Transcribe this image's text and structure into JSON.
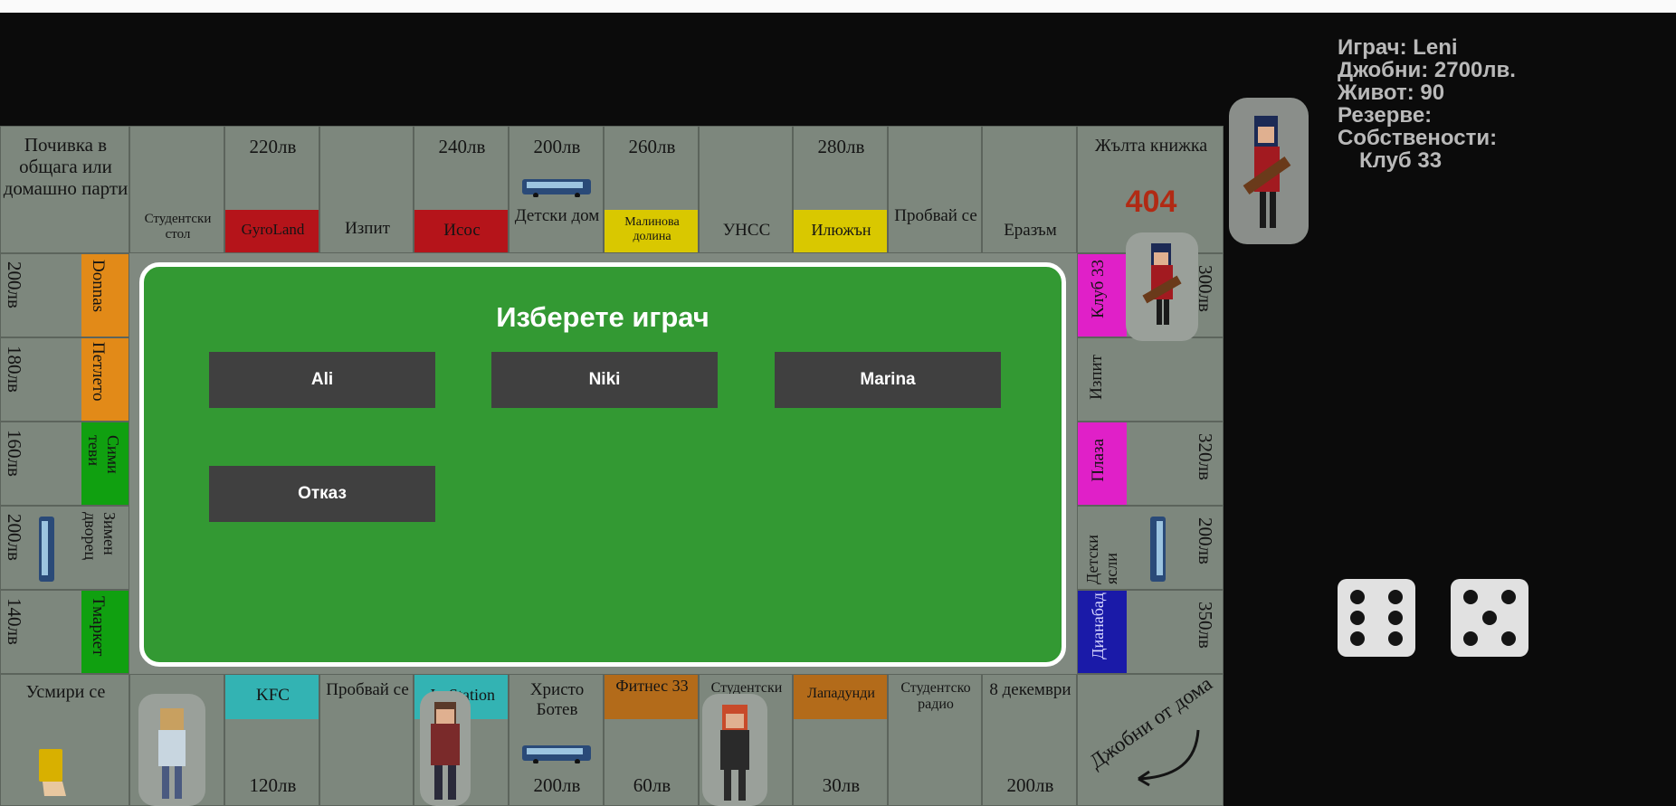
{
  "colors": {
    "modal_bg": "#339933",
    "button_bg": "#404040",
    "hud_text": "#b9b9b9",
    "background": "#0b0b0b"
  },
  "top_row": [
    {
      "name": "Почивка в общага или домашно парти",
      "kind": "corner"
    },
    {
      "name": "Студентски стол",
      "kind": "utility"
    },
    {
      "name": "GyroLand",
      "price": "220лв",
      "color": "#b5141a"
    },
    {
      "name": "Изпит",
      "kind": "card"
    },
    {
      "name": "Исос",
      "price": "240лв",
      "color": "#b5141a"
    },
    {
      "name": "Детски дом",
      "price": "200лв",
      "kind": "station",
      "icon": "bus-icon"
    },
    {
      "name": "Малинова долина",
      "price": "260лв",
      "color": "#d9c800"
    },
    {
      "name": "УНСС",
      "kind": "plain"
    },
    {
      "name": "Илюжън",
      "price": "280лв",
      "color": "#d9c800"
    },
    {
      "name": "Пробвай се",
      "kind": "chance"
    },
    {
      "name": "Еразъм",
      "kind": "plain"
    },
    {
      "name": "Жълта книжка",
      "kind": "corner",
      "badge": "404"
    }
  ],
  "left_col": [
    {
      "name": "Donnas",
      "price": "200лв",
      "color": "#e28a18"
    },
    {
      "name": "Петлето",
      "price": "180лв",
      "color": "#e28a18"
    },
    {
      "name": "Сими теви",
      "price": "160лв",
      "color": "#10a010"
    },
    {
      "name": "Зимен дворец",
      "price": "200лв",
      "kind": "station",
      "icon": "bus-icon"
    },
    {
      "name": "Тмаркет",
      "price": "140лв",
      "color": "#10a010"
    }
  ],
  "right_col": [
    {
      "name": "Клуб 33",
      "price": "300лв",
      "color": "#e020c8"
    },
    {
      "name": "Изпит",
      "kind": "card"
    },
    {
      "name": "Плаза",
      "price": "320лв",
      "color": "#e020c8"
    },
    {
      "name": "Детски ясли",
      "price": "200лв",
      "kind": "station",
      "icon": "bus-icon"
    },
    {
      "name": "Дианабад",
      "price": "350лв",
      "color": "#1a1aa8"
    }
  ],
  "bottom_row": [
    {
      "name": "Усмири се",
      "kind": "corner",
      "icon": "yellow-card-icon"
    },
    {
      "name": "",
      "kind": "plain"
    },
    {
      "name": "KFC",
      "price": "120лв",
      "color": "#33b3b3"
    },
    {
      "name": "Пробвай се",
      "kind": "chance"
    },
    {
      "name": "Jo-Station",
      "price": "лв",
      "color": "#33b3b3"
    },
    {
      "name": "Христо Ботев",
      "price": "200лв",
      "kind": "station",
      "icon": "bus-icon"
    },
    {
      "name": "Фитнес 33",
      "price": "60лв",
      "color": "#b36b1a"
    },
    {
      "name": "Студентски",
      "kind": "utility"
    },
    {
      "name": "Лападунди",
      "price": "30лв",
      "color": "#b36b1a"
    },
    {
      "name": "Студентско радио",
      "kind": "plain"
    },
    {
      "name": "8 декември",
      "price": "200лв",
      "kind": "plain"
    },
    {
      "name": "Джобни от дома",
      "kind": "corner"
    }
  ],
  "modal": {
    "title": "Изберете играч",
    "buttons": [
      "Ali",
      "Niki",
      "Marina"
    ],
    "cancel": "Отказ"
  },
  "hud": {
    "player": "Играч: Leni",
    "money": "Джобни: 2700лв.",
    "life": "Живот: 90",
    "reserve": "Резерве:",
    "properties_label": "Собствености:",
    "properties": [
      "Клуб 33"
    ]
  },
  "dice": [
    6,
    5
  ]
}
